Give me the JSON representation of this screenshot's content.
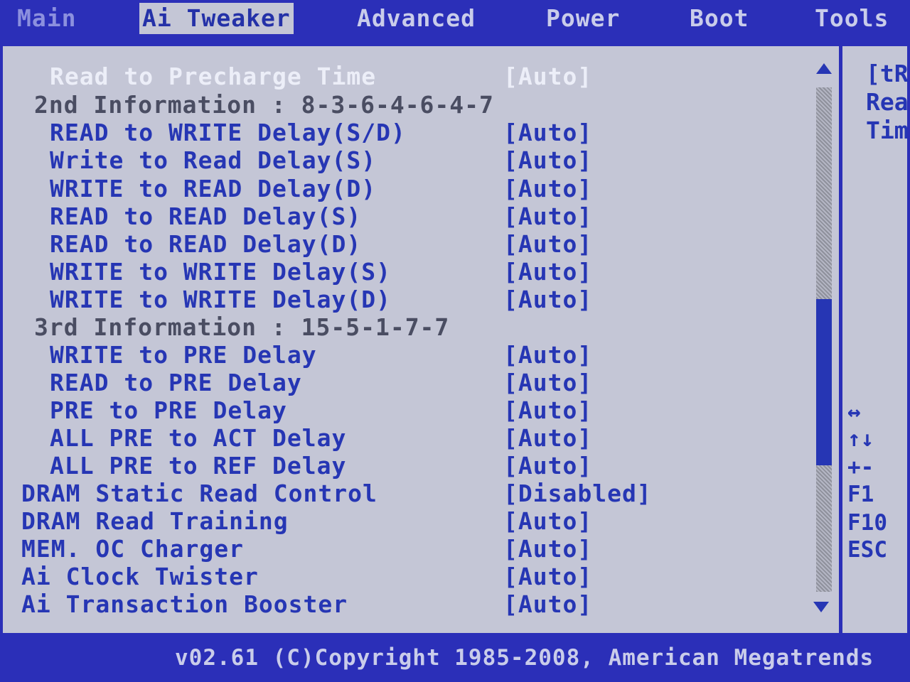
{
  "tabs": [
    {
      "label": "Main"
    },
    {
      "label": "Ai Tweaker"
    },
    {
      "label": "Advanced"
    },
    {
      "label": "Power"
    },
    {
      "label": "Boot"
    },
    {
      "label": "Tools"
    }
  ],
  "settings": [
    {
      "label": "Read to Precharge Time",
      "value": "[Auto]"
    },
    {
      "label": "2nd Information : 8-3-6-4-6-4-7",
      "value": ""
    },
    {
      "label": "READ to WRITE Delay(S/D)",
      "value": "[Auto]"
    },
    {
      "label": "Write to Read Delay(S)",
      "value": "[Auto]"
    },
    {
      "label": "WRITE to READ Delay(D)",
      "value": "[Auto]"
    },
    {
      "label": "READ to READ Delay(S)",
      "value": "[Auto]"
    },
    {
      "label": "READ to READ Delay(D)",
      "value": "[Auto]"
    },
    {
      "label": "WRITE to WRITE Delay(S)",
      "value": "[Auto]"
    },
    {
      "label": "WRITE to WRITE Delay(D)",
      "value": "[Auto]"
    },
    {
      "label": "3rd Information : 15-5-1-7-7",
      "value": ""
    },
    {
      "label": "WRITE to PRE Delay",
      "value": "[Auto]"
    },
    {
      "label": "READ to PRE Delay",
      "value": "[Auto]"
    },
    {
      "label": "PRE to PRE Delay",
      "value": "[Auto]"
    },
    {
      "label": "ALL PRE to ACT Delay",
      "value": "[Auto]"
    },
    {
      "label": "ALL PRE to REF Delay",
      "value": "[Auto]"
    },
    {
      "label": "DRAM Static Read Control",
      "value": "[Disabled]"
    },
    {
      "label": "DRAM Read Training",
      "value": "[Auto]"
    },
    {
      "label": "MEM. OC Charger",
      "value": "[Auto]"
    },
    {
      "label": "Ai Clock Twister",
      "value": "[Auto]"
    },
    {
      "label": "Ai Transaction Booster",
      "value": "[Auto]"
    }
  ],
  "scrollbar": {
    "thumb_start_fraction": 0.42,
    "thumb_end_fraction": 0.75
  },
  "help": {
    "lines": [
      "[tR",
      "Rea",
      "Tim"
    ]
  },
  "keys": [
    "↔",
    "↑↓",
    "+-",
    "F1",
    "F10",
    "ESC"
  ],
  "footer": {
    "text": "v02.61 (C)Copyright 1985-2008, American Megatrends"
  },
  "colors": {
    "background": "#2b2fb8",
    "panel": "#c4c6d6",
    "text": "#2636b4",
    "highlight_text": "#eceef8"
  }
}
